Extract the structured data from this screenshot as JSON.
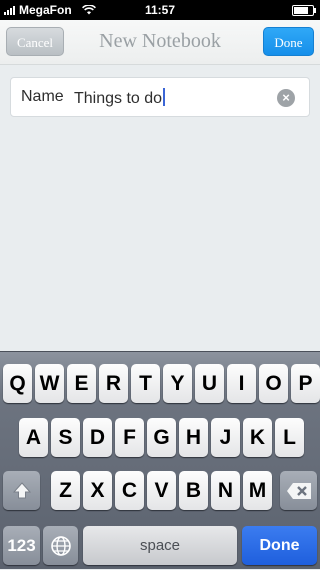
{
  "status": {
    "carrier": "MegaFon",
    "time": "11:57",
    "signal_bars": 4,
    "wifi_icon": "wifi-icon",
    "battery_level": 0.85
  },
  "nav": {
    "cancel": "Cancel",
    "title": "New Notebook",
    "done": "Done"
  },
  "form": {
    "name_label": "Name",
    "name_value": "Things to do",
    "clear_icon": "clear-icon"
  },
  "keyboard": {
    "row1": [
      "Q",
      "W",
      "E",
      "R",
      "T",
      "Y",
      "U",
      "I",
      "O",
      "P"
    ],
    "row2": [
      "A",
      "S",
      "D",
      "F",
      "G",
      "H",
      "J",
      "K",
      "L"
    ],
    "row3": [
      "Z",
      "X",
      "C",
      "V",
      "B",
      "N",
      "M"
    ],
    "num_key": "123",
    "space": "space",
    "done": "Done",
    "shift_icon": "shift-icon",
    "delete_icon": "delete-icon",
    "globe_icon": "globe-icon"
  },
  "colors": {
    "accent": "#168fea",
    "done_key": "#1f5fdd",
    "caret": "#3b66d6"
  }
}
